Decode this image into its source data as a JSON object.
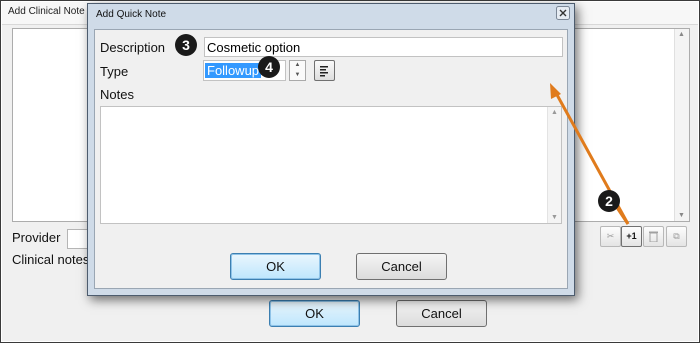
{
  "background_window": {
    "title": "Add Clinical Note",
    "provider_label": "Provider",
    "clinical_notes_label": "Clinical notes",
    "toolbar": {
      "add_button_label": "+1",
      "icons": [
        "cut-icon",
        "add-one-icon",
        "trash-icon",
        "copy-icon"
      ]
    },
    "ok_label": "OK",
    "cancel_label": "Cancel"
  },
  "dialog": {
    "title": "Add Quick Note",
    "description_label": "Description",
    "description_value": "Cosmetic option",
    "type_label": "Type",
    "type_value": "Followup",
    "notes_label": "Notes",
    "notes_value": "",
    "ok_label": "OK",
    "cancel_label": "Cancel"
  },
  "callouts": {
    "badge_2": "2",
    "badge_3": "3",
    "badge_4": "4",
    "arrow_color": "#e07b1c"
  },
  "colors": {
    "dialog_frame": "#cfdbe8",
    "selection": "#3399ff",
    "default_button": "#bee6fd"
  }
}
